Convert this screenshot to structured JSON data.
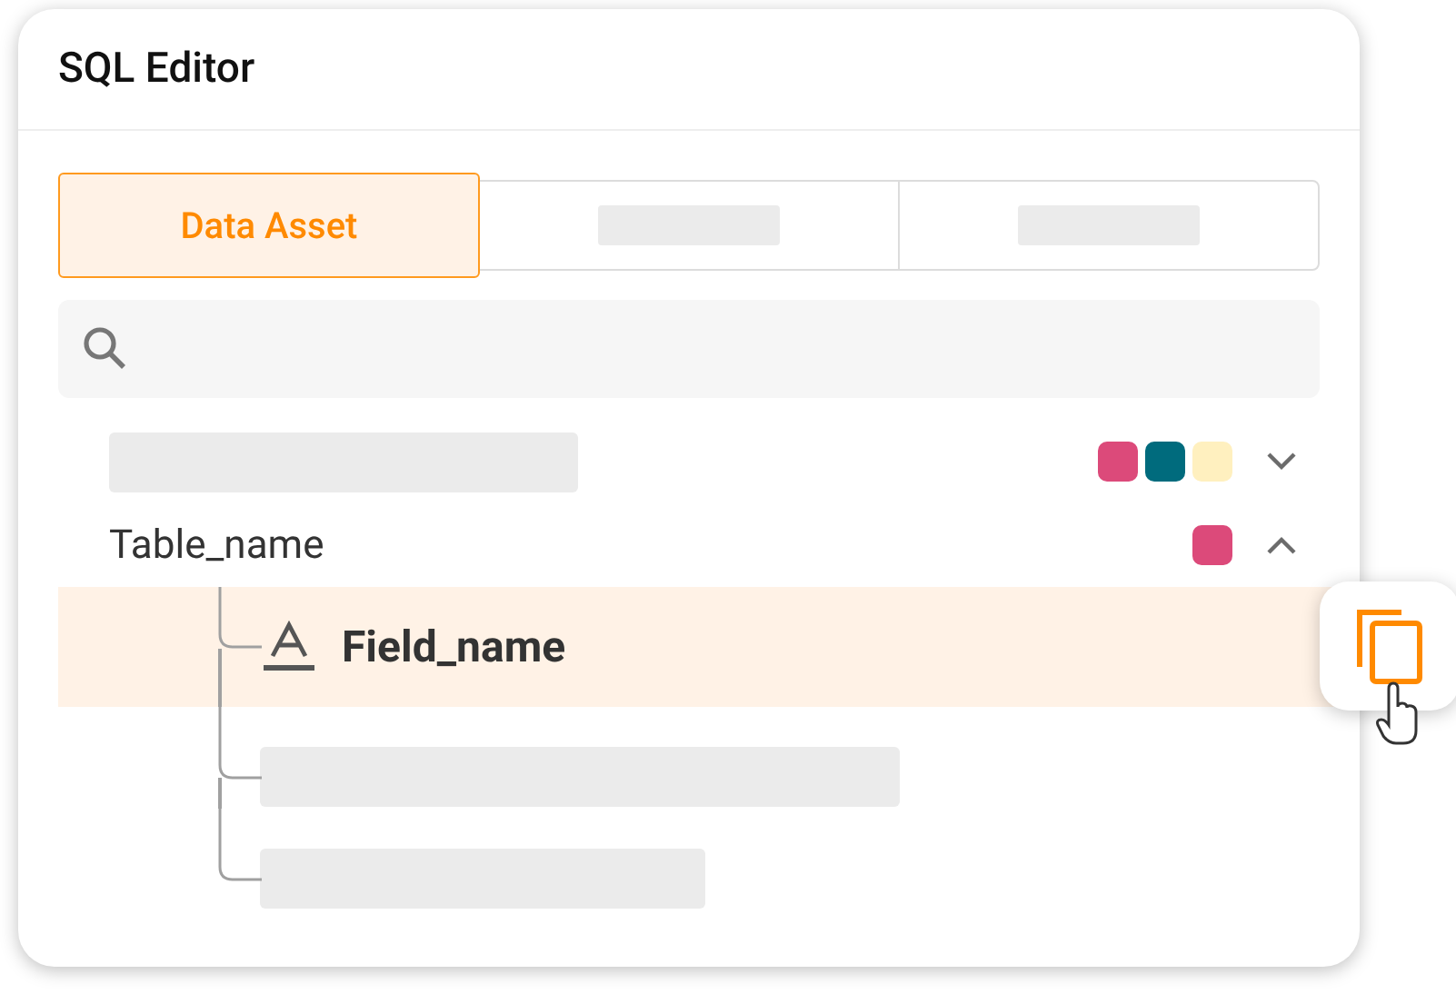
{
  "window": {
    "title": "SQL Editor"
  },
  "tabs": [
    {
      "kind": "label",
      "label": "Data Asset",
      "selected": true
    },
    {
      "kind": "placeholder",
      "selected": false
    },
    {
      "kind": "placeholder",
      "selected": false
    }
  ],
  "search": {
    "kind": "search"
  },
  "tree": [
    {
      "kind": "placeholder",
      "expanded": false,
      "tags": [
        {
          "color": "#dc4a7a"
        },
        {
          "color": "#006b7d"
        },
        {
          "color": "#fff0bf"
        }
      ]
    },
    {
      "kind": "table",
      "name": "Table_name",
      "expanded": true,
      "tags": [
        {
          "color": "#dc4a7a"
        }
      ],
      "children": [
        {
          "kind": "field",
          "name": "Field_name",
          "selected": true
        },
        {
          "kind": "placeholder",
          "selected": false
        },
        {
          "kind": "placeholder",
          "selected": false
        }
      ]
    }
  ],
  "copy_button": {
    "kind": "copy"
  }
}
